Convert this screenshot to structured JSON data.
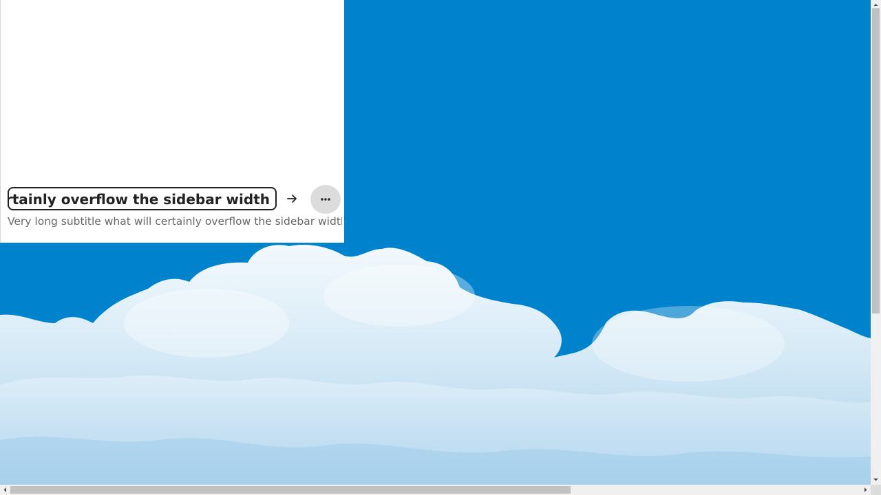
{
  "sidebar": {
    "title": "Very long title what will certainly overflow the sidebar width",
    "subtitle": "Very long subtitle what will certainly overflow the sidebar width"
  },
  "icons": {
    "go": "arrow-right-icon",
    "more": "ellipsis-icon"
  },
  "colors": {
    "sky": "#0082cc",
    "sidebar_bg": "#ffffff",
    "title_border": "#222222",
    "subtitle_text": "#666666",
    "more_button_bg": "#dcdcdc"
  }
}
